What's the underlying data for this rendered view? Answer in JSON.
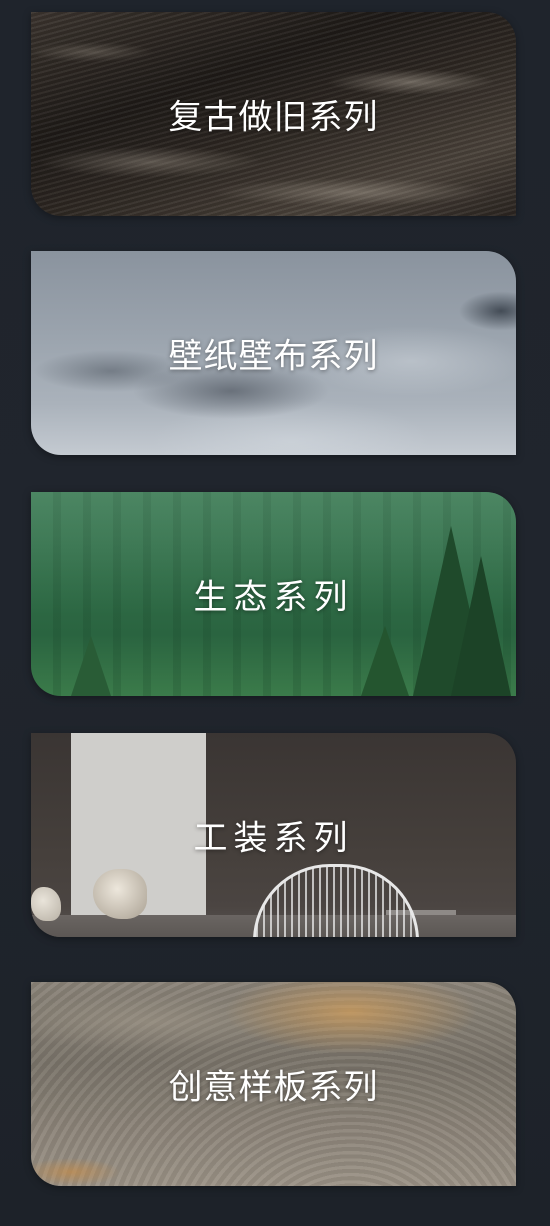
{
  "cards": [
    {
      "label": "复古做旧系列",
      "theme": "dark-sand"
    },
    {
      "label": "壁纸壁布系列",
      "theme": "grey-ice"
    },
    {
      "label": "生态系列",
      "theme": "green-forest"
    },
    {
      "label": "工装系列",
      "theme": "interior"
    },
    {
      "label": "创意样板系列",
      "theme": "sandstone"
    }
  ],
  "colors": {
    "background": "#1f242c",
    "label_text": "#ffffff"
  }
}
